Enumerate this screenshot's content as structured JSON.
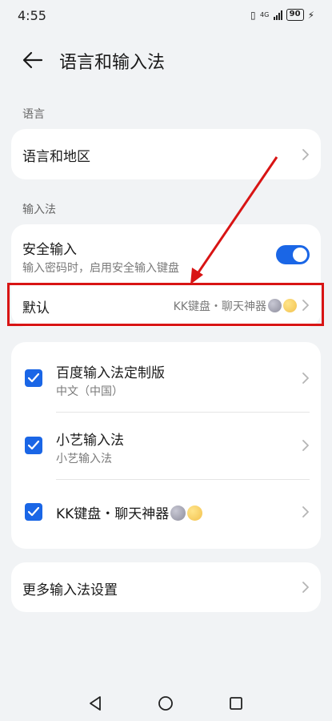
{
  "status": {
    "time": "4:55",
    "network": "4G",
    "battery": "90"
  },
  "header": {
    "title": "语言和输入法"
  },
  "sections": {
    "language_label": "语言",
    "input_label": "输入法"
  },
  "language_region": {
    "label": "语言和地区"
  },
  "secure_input": {
    "title": "安全输入",
    "subtitle": "输入密码时，启用安全输入键盘",
    "enabled": true
  },
  "default_row": {
    "title": "默认",
    "value": "KK键盘・聊天神器"
  },
  "input_methods": [
    {
      "name": "百度输入法定制版",
      "subtitle": "中文（中国）",
      "checked": true
    },
    {
      "name": "小艺输入法",
      "subtitle": "小艺输入法",
      "checked": true
    },
    {
      "name": "KK键盘・聊天神器",
      "subtitle": "",
      "checked": true
    }
  ],
  "more_settings": {
    "label": "更多输入法设置"
  },
  "colors": {
    "accent": "#1a66e6",
    "highlight": "#d81414",
    "background": "#f1f3f5"
  }
}
